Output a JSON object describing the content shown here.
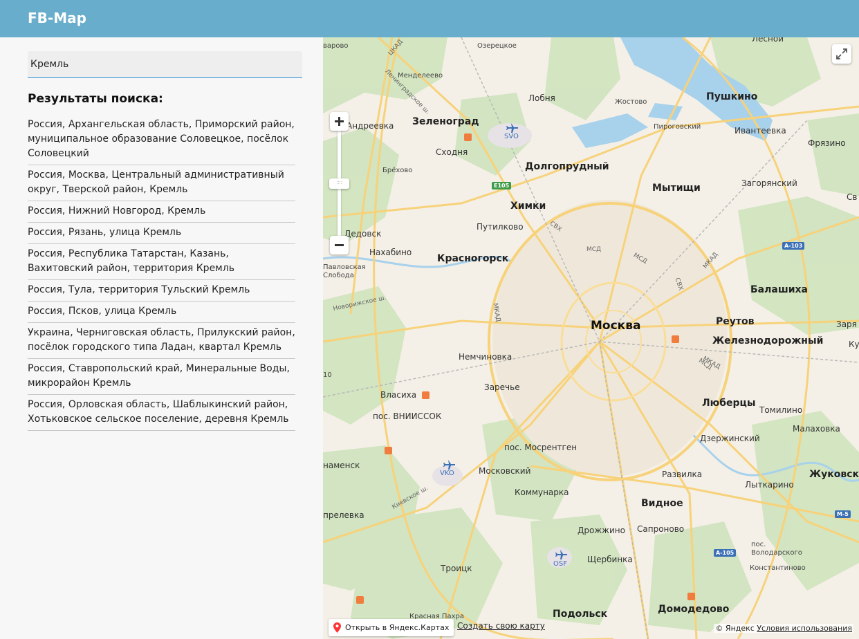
{
  "header": {
    "title": "FB-Map"
  },
  "search": {
    "value": "Кремль"
  },
  "results": {
    "title": "Результаты поиска:",
    "items": [
      "Россия, Архангельская область, Приморский район, муниципальное образование Соловецкое, посёлок Соловецкий",
      "Россия, Москва, Центральный административный округ, Тверской район, Кремль",
      "Россия, Нижний Новгород, Кремль",
      "Россия, Рязань, улица Кремль",
      "Россия, Республика Татарстан, Казань, Вахитовский район, территория Кремль",
      "Россия, Тула, территория Тульский Кремль",
      "Россия, Псков, улица Кремль",
      "Украина, Черниговская область, Прилукский район, посёлок городского типа Ладан, квартал Кремль",
      "Россия, Ставропольский край, Минеральные Воды, микрорайон Кремль",
      "Россия, Орловская область, Шаблыкинский район, Хотьковское сельское поселение, деревня Кремль"
    ]
  },
  "map": {
    "labels": {
      "moskva": "Москва",
      "zelenograd": "Зеленоград",
      "dolgoprudny": "Долгопрудный",
      "khimki": "Химки",
      "mytishchi": "Мытищи",
      "pushkino": "Пушкино",
      "krasnogorsk": "Красногорск",
      "balashikha": "Балашиха",
      "reutov": "Реутов",
      "zheleznodorozhny": "Железнодорожный",
      "lyubertsy": "Люберцы",
      "vidnoe": "Видное",
      "podolsk": "Подольск",
      "domodedovo": "Домодедово",
      "zhukovsky": "Жуковский",
      "lobnya": "Лобня",
      "skhodnya": "Сходня",
      "andreevka": "Андреевка",
      "brekhovo": "Брёхово",
      "putilkovo": "Путилково",
      "nakhabino": "Нахабино",
      "dedovsk": "Дедовск",
      "pavlovskaya_sloboda": "Павловская Слобода",
      "nemchinovka": "Немчиновка",
      "zarechye": "Заречье",
      "vlasikha": "Власиха",
      "vniissok": "пос. ВНИИССОК",
      "mosrentgen": "пос. Мосрентген",
      "moskovsky": "Московский",
      "kommunarka": "Коммунарка",
      "drozhzhino": "Дрожжино",
      "sapronovo": "Сапроново",
      "shcherbinka": "Щербинка",
      "troitsk": "Троицк",
      "krasnaya_pakhra": "Красная Пахра",
      "razvilka": "Развилка",
      "lytkarino": "Лыткарино",
      "dzerzhinsky": "Дзержинский",
      "tomilino": "Томилино",
      "malakhovka": "Малаховка",
      "volodarskogo": "пос. Володарского",
      "konstantinovo": "Константиново",
      "ivanteevka": "Ивантеевка",
      "fryazino": "Фрязино",
      "zagoryansky": "Загорянский",
      "pirogovsky": "Пироговский",
      "zhostovo": "Жостово",
      "ozeretskoe": "Озерецкое",
      "mendeleevo": "Менделеево",
      "lesnoy": "Лесной",
      "barovo": "варово",
      "naro": "наменск",
      "aprelevka": "прелевка",
      "zarya": "Заря",
      "ku": "Ку",
      "sv": "Св",
      "svo": "SVO",
      "vko": "VKO",
      "osf": "OSF",
      "mkad1": "МКАД",
      "mkad2": "МКАД",
      "mkad3": "МКАД",
      "msd1": "МСД",
      "msd2": "МСД",
      "msd3": "МСД",
      "svkh1": "СВХ",
      "svkh2": "СВХ",
      "leningradskoe": "Ленинградское ш.",
      "novorizhskoe": "Новорижское ш.",
      "kievskoe": "Киевское ш.",
      "ckad": "ЦКАД",
      "ten": "10"
    },
    "road_badges": {
      "e105": "E105",
      "a103": "A-103",
      "a105": "A-105",
      "m5": "M-5"
    },
    "open_in_yandex": "Открыть в Яндекс.Картах",
    "create_map": "Создать свою карту",
    "copyright": "© Яндекс",
    "terms": "Условия использования"
  }
}
